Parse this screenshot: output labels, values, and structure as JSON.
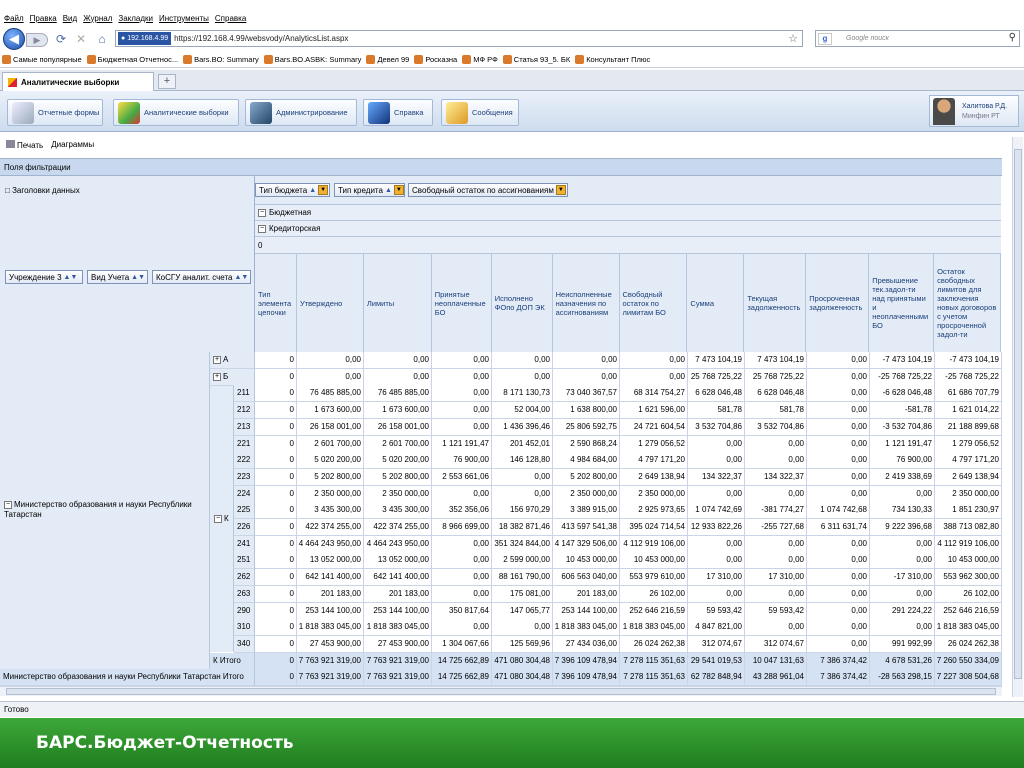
{
  "browser": {
    "menu": [
      "Файл",
      "Правка",
      "Вид",
      "Журнал",
      "Закладки",
      "Инструменты",
      "Справка"
    ],
    "ip_badge": "192.168.4.99",
    "url": "https://192.168.4.99/websvody/AnalyticsList.aspx",
    "search_placeholder": "Google поиск",
    "bookmarks": [
      "Самые популярные",
      "Бюджетная Отчетнос...",
      "Bars.BO: Summary",
      "Bars.BO.ASBK: Summary",
      "Девел 99",
      "Росказна",
      "МФ РФ",
      "Статья 93_5. БК",
      "Консультант Плюс"
    ],
    "tab_title": "Аналитические выборки"
  },
  "app": {
    "buttons": [
      "Отчетные формы",
      "Аналитические выборки",
      "Администрирование",
      "Справка",
      "Сообщения"
    ],
    "user_name": "Халитова Р.Д.",
    "user_org": "Минфин РТ"
  },
  "report": {
    "print_label": "Печать",
    "charts_label": "Диаграммы",
    "filter_fields": "Поля фильтрации",
    "data_headers": "Заголовки данных",
    "col_chips": [
      "Тип бюджета",
      "Тип кредита",
      "Свободный остаток по ассигнованиям"
    ],
    "row_chips": [
      "Учреждение 3",
      "Вид Учета",
      "КоСГУ аналит. счета"
    ],
    "band1": "Бюджетная",
    "band2": "Кредиторская",
    "band3": "0",
    "columns": [
      "Тип элемента цепочки",
      "Утверждено",
      "Лимиты",
      "Принятые неоплаченные БО",
      "Исполнено ФОпо ДОП ЭК",
      "Неисполненные назначения по ассигнованиям",
      "Свободный остаток по лимитам БО",
      "Сумма",
      "Текущая задолженность",
      "Просроченная задолженность",
      "Превышение тек.задол-ти над принятыми и неоплаченными БО",
      "Остаток свободных лимитов для заключения новых договоров с учетом просроченной задол-ти"
    ],
    "ministry": "Министерство образования и науки Республики Татарстан",
    "group_k": "К",
    "group_k_total": "К Итого",
    "grand_total_label": "Министерство образования и науки Республики Татарстан Итого",
    "rows": [
      {
        "code": "А",
        "vals": [
          "0",
          "0,00",
          "0,00",
          "0,00",
          "0,00",
          "0,00",
          "0,00",
          "7 473 104,19",
          "7 473 104,19",
          "0,00",
          "-7 473 104,19",
          "-7 473 104,19"
        ]
      },
      {
        "code": "Б",
        "vals": [
          "0",
          "0,00",
          "0,00",
          "0,00",
          "0,00",
          "0,00",
          "0,00",
          "25 768 725,22",
          "25 768 725,22",
          "0,00",
          "-25 768 725,22",
          "-25 768 725,22"
        ]
      },
      {
        "code": "211",
        "vals": [
          "0",
          "76 485 885,00",
          "76 485 885,00",
          "0,00",
          "8 171 130,73",
          "73 040 367,57",
          "68 314 754,27",
          "6 628 046,48",
          "6 628 046,48",
          "0,00",
          "-6 628 046,48",
          "61 686 707,79"
        ]
      },
      {
        "code": "212",
        "vals": [
          "0",
          "1 673 600,00",
          "1 673 600,00",
          "0,00",
          "52 004,00",
          "1 638 800,00",
          "1 621 596,00",
          "581,78",
          "581,78",
          "0,00",
          "-581,78",
          "1 621 014,22"
        ]
      },
      {
        "code": "213",
        "vals": [
          "0",
          "26 158 001,00",
          "26 158 001,00",
          "0,00",
          "1 436 396,46",
          "25 806 592,75",
          "24 721 604,54",
          "3 532 704,86",
          "3 532 704,86",
          "0,00",
          "-3 532 704,86",
          "21 188 899,68"
        ]
      },
      {
        "code": "221",
        "vals": [
          "0",
          "2 601 700,00",
          "2 601 700,00",
          "1 121 191,47",
          "201 452,01",
          "2 590 868,24",
          "1 279 056,52",
          "0,00",
          "0,00",
          "0,00",
          "1 121 191,47",
          "1 279 056,52"
        ]
      },
      {
        "code": "222",
        "vals": [
          "0",
          "5 020 200,00",
          "5 020 200,00",
          "76 900,00",
          "146 128,80",
          "4 984 684,00",
          "4 797 171,20",
          "0,00",
          "0,00",
          "0,00",
          "76 900,00",
          "4 797 171,20"
        ]
      },
      {
        "code": "223",
        "vals": [
          "0",
          "5 202 800,00",
          "5 202 800,00",
          "2 553 661,06",
          "0,00",
          "5 202 800,00",
          "2 649 138,94",
          "134 322,37",
          "134 322,37",
          "0,00",
          "2 419 338,69",
          "2 649 138,94"
        ]
      },
      {
        "code": "224",
        "vals": [
          "0",
          "2 350 000,00",
          "2 350 000,00",
          "0,00",
          "0,00",
          "2 350 000,00",
          "2 350 000,00",
          "0,00",
          "0,00",
          "0,00",
          "0,00",
          "2 350 000,00"
        ]
      },
      {
        "code": "225",
        "vals": [
          "0",
          "3 435 300,00",
          "3 435 300,00",
          "352 356,06",
          "156 970,29",
          "3 389 915,00",
          "2 925 973,65",
          "1 074 742,69",
          "-381 774,27",
          "1 074 742,68",
          "734 130,33",
          "1 851 230,97"
        ]
      },
      {
        "code": "226",
        "vals": [
          "0",
          "422 374 255,00",
          "422 374 255,00",
          "8 966 699,00",
          "18 382 871,46",
          "413 597 541,38",
          "395 024 714,54",
          "12 933 822,26",
          "-255 727,68",
          "6 311 631,74",
          "9 222 396,68",
          "388 713 082,80"
        ]
      },
      {
        "code": "241",
        "vals": [
          "0",
          "4 464 243 950,00",
          "4 464 243 950,00",
          "0,00",
          "351 324 844,00",
          "4 147 329 506,00",
          "4 112 919 106,00",
          "0,00",
          "0,00",
          "0,00",
          "0,00",
          "4 112 919 106,00"
        ]
      },
      {
        "code": "251",
        "vals": [
          "0",
          "13 052 000,00",
          "13 052 000,00",
          "0,00",
          "2 599 000,00",
          "10 453 000,00",
          "10 453 000,00",
          "0,00",
          "0,00",
          "0,00",
          "0,00",
          "10 453 000,00"
        ]
      },
      {
        "code": "262",
        "vals": [
          "0",
          "642 141 400,00",
          "642 141 400,00",
          "0,00",
          "88 161 790,00",
          "606 563 040,00",
          "553 979 610,00",
          "17 310,00",
          "17 310,00",
          "0,00",
          "-17 310,00",
          "553 962 300,00"
        ]
      },
      {
        "code": "263",
        "vals": [
          "0",
          "201 183,00",
          "201 183,00",
          "0,00",
          "175 081,00",
          "201 183,00",
          "26 102,00",
          "0,00",
          "0,00",
          "0,00",
          "0,00",
          "26 102,00"
        ]
      },
      {
        "code": "290",
        "vals": [
          "0",
          "253 144 100,00",
          "253 144 100,00",
          "350 817,64",
          "147 065,77",
          "253 144 100,00",
          "252 646 216,59",
          "59 593,42",
          "59 593,42",
          "0,00",
          "291 224,22",
          "252 646 216,59"
        ]
      },
      {
        "code": "310",
        "vals": [
          "0",
          "1 818 383 045,00",
          "1 818 383 045,00",
          "0,00",
          "0,00",
          "1 818 383 045,00",
          "1 818 383 045,00",
          "4 847 821,00",
          "0,00",
          "0,00",
          "0,00",
          "1 818 383 045,00"
        ]
      },
      {
        "code": "340",
        "vals": [
          "0",
          "27 453 900,00",
          "27 453 900,00",
          "1 304 067,66",
          "125 569,96",
          "27 434 036,00",
          "26 024 262,38",
          "312 074,67",
          "312 074,67",
          "0,00",
          "991 992,99",
          "26 024 262,38"
        ]
      }
    ],
    "k_total": [
      "0",
      "7 763 921 319,00",
      "7 763 921 319,00",
      "14 725 662,89",
      "471 080 304,48",
      "7 396 109 478,94",
      "7 278 115 351,63",
      "29 541 019,53",
      "10 047 131,63",
      "7 386 374,42",
      "4 678 531,26",
      "7 260 550 334,09"
    ],
    "grand_total": [
      "0",
      "7 763 921 319,00",
      "7 763 921 319,00",
      "14 725 662,89",
      "471 080 304,48",
      "7 396 109 478,94",
      "7 278 115 351,63",
      "62 782 848,94",
      "43 288 961,04",
      "7 386 374,42",
      "-28 563 298,15",
      "7 227 308 504,68"
    ]
  },
  "status": "Готово",
  "footer_brand": "БАРС.Бюджет-Отчетность",
  "colors": {
    "accent": "#2a55a5",
    "footer_green": "#2e9a2b",
    "header_bg": "#e3ebf6"
  }
}
